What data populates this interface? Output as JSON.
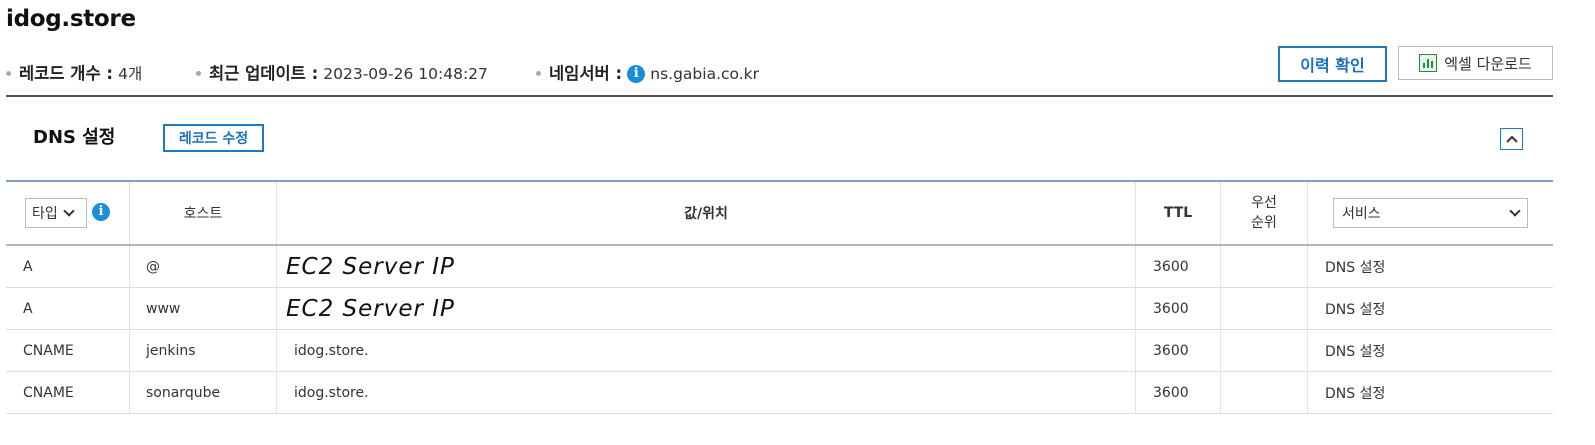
{
  "domain": {
    "name": "idog.store"
  },
  "meta": {
    "record_count_label": "레코드 개수 :",
    "record_count_value": "4개",
    "last_update_label": "최근 업데이트 :",
    "last_update_value": "2023-09-26 10:48:27",
    "nameserver_label": "네임서버 :",
    "nameserver_value": "ns.gabia.co.kr",
    "info_glyph": "i"
  },
  "buttons": {
    "history": "이력 확인",
    "excel_download": "엑셀 다운로드",
    "edit_record": "레코드 수정"
  },
  "section": {
    "title": "DNS 설정"
  },
  "table": {
    "headers": {
      "type_select": "타입",
      "host": "호스트",
      "value": "값/위치",
      "ttl": "TTL",
      "priority_line1": "우선",
      "priority_line2": "순위",
      "service_select": "서비스"
    },
    "rows": [
      {
        "type": "A",
        "host": "@",
        "value": "EC2 Server IP",
        "ttl": "3600",
        "priority": "",
        "service": "DNS 설정"
      },
      {
        "type": "A",
        "host": "www",
        "value": "EC2 Server IP",
        "ttl": "3600",
        "priority": "",
        "service": "DNS 설정"
      },
      {
        "type": "CNAME",
        "host": "jenkins",
        "value": "idog.store.",
        "ttl": "3600",
        "priority": "",
        "service": "DNS 설정"
      },
      {
        "type": "CNAME",
        "host": "sonarqube",
        "value": "idog.store.",
        "ttl": "3600",
        "priority": "",
        "service": "DNS 설정"
      }
    ]
  },
  "colors": {
    "accent_blue": "#1c7ac4",
    "info_blue": "#1a8fd8",
    "excel_green": "#1f8f3c"
  },
  "icons": [
    "info-icon",
    "excel-icon",
    "chevron-up-icon",
    "chevron-down-icon"
  ]
}
